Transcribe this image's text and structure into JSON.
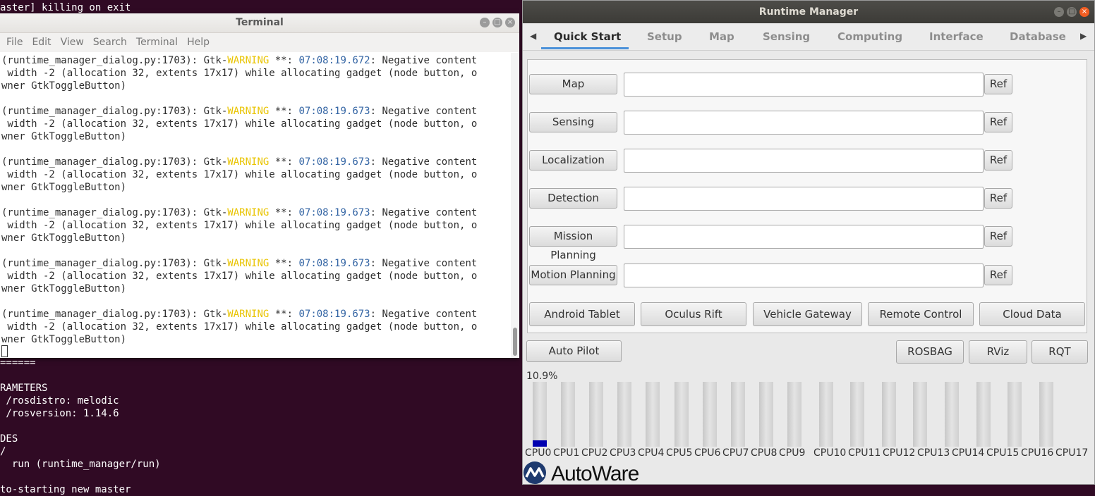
{
  "background_terminal": {
    "lines": [
      "aster] killing on exit",
      "======",
      "RAMETERS",
      " /rosdistro: melodic",
      " /rosversion: 1.14.6",
      "",
      "DES",
      "/",
      "  run (runtime_manager/run)",
      "",
      "to-starting new master"
    ]
  },
  "terminal": {
    "title": "Terminal",
    "menu": [
      "File",
      "Edit",
      "View",
      "Search",
      "Terminal",
      "Help"
    ],
    "entries": [
      {
        "prefix": "(runtime_manager_dialog.py:1703): Gtk-",
        "level": "WARNING",
        "mid": " **: ",
        "time": "07:08:19.672",
        "suffix": ": Negative content",
        "line2": " width -2 (allocation 32, extents 17x17) while allocating gadget (node button, o",
        "line3": "wner GtkToggleButton)"
      },
      {
        "prefix": "(runtime_manager_dialog.py:1703): Gtk-",
        "level": "WARNING",
        "mid": " **: ",
        "time": "07:08:19.673",
        "suffix": ": Negative content",
        "line2": " width -2 (allocation 32, extents 17x17) while allocating gadget (node button, o",
        "line3": "wner GtkToggleButton)"
      },
      {
        "prefix": "(runtime_manager_dialog.py:1703): Gtk-",
        "level": "WARNING",
        "mid": " **: ",
        "time": "07:08:19.673",
        "suffix": ": Negative content",
        "line2": " width -2 (allocation 32, extents 17x17) while allocating gadget (node button, o",
        "line3": "wner GtkToggleButton)"
      },
      {
        "prefix": "(runtime_manager_dialog.py:1703): Gtk-",
        "level": "WARNING",
        "mid": " **: ",
        "time": "07:08:19.673",
        "suffix": ": Negative content",
        "line2": " width -2 (allocation 32, extents 17x17) while allocating gadget (node button, o",
        "line3": "wner GtkToggleButton)"
      },
      {
        "prefix": "(runtime_manager_dialog.py:1703): Gtk-",
        "level": "WARNING",
        "mid": " **: ",
        "time": "07:08:19.673",
        "suffix": ": Negative content",
        "line2": " width -2 (allocation 32, extents 17x17) while allocating gadget (node button, o",
        "line3": "wner GtkToggleButton)"
      },
      {
        "prefix": "(runtime_manager_dialog.py:1703): Gtk-",
        "level": "WARNING",
        "mid": " **: ",
        "time": "07:08:19.673",
        "suffix": ": Negative content",
        "line2": " width -2 (allocation 32, extents 17x17) while allocating gadget (node button, o",
        "line3": "wner GtkToggleButton)"
      }
    ]
  },
  "runtime_manager": {
    "title": "Runtime Manager",
    "tabs": [
      "Quick Start",
      "Setup",
      "Map",
      "Sensing",
      "Computing",
      "Interface",
      "Database"
    ],
    "active_tab": "Quick Start",
    "rows": [
      {
        "label": "Map",
        "value": "",
        "ref": "Ref"
      },
      {
        "label": "Sensing",
        "value": "",
        "ref": "Ref"
      },
      {
        "label": "Localization",
        "value": "",
        "ref": "Ref"
      },
      {
        "label": "Detection",
        "value": "",
        "ref": "Ref"
      },
      {
        "label": "Mission Planning",
        "value": "",
        "ref": "Ref"
      },
      {
        "label": "Motion Planning",
        "value": "",
        "ref": "Ref"
      }
    ],
    "bottom_buttons": [
      "Android Tablet",
      "Oculus Rift",
      "Vehicle Gateway",
      "Remote Control",
      "Cloud Data"
    ],
    "auto_pilot": "Auto Pilot",
    "tool_buttons": [
      "ROSBAG",
      "RViz",
      "RQT"
    ],
    "cpu_percent_label": "10.9%",
    "cpus": [
      {
        "name": "CPU0",
        "level": 0.1
      },
      {
        "name": "CPU1",
        "level": 0
      },
      {
        "name": "CPU2",
        "level": 0
      },
      {
        "name": "CPU3",
        "level": 0
      },
      {
        "name": "CPU4",
        "level": 0
      },
      {
        "name": "CPU5",
        "level": 0
      },
      {
        "name": "CPU6",
        "level": 0
      },
      {
        "name": "CPU7",
        "level": 0
      },
      {
        "name": "CPU8",
        "level": 0
      },
      {
        "name": "CPU9",
        "level": 0
      },
      {
        "name": "CPU10",
        "level": 0
      },
      {
        "name": "CPU11",
        "level": 0
      },
      {
        "name": "CPU12",
        "level": 0
      },
      {
        "name": "CPU13",
        "level": 0
      },
      {
        "name": "CPU14",
        "level": 0
      },
      {
        "name": "CPU15",
        "level": 0
      },
      {
        "name": "CPU16",
        "level": 0
      },
      {
        "name": "CPU17",
        "level": 0
      }
    ],
    "logo_text": "AutoWare",
    "accent_color": "#4a90d9",
    "cpu_fill_color": "#0000b0"
  }
}
